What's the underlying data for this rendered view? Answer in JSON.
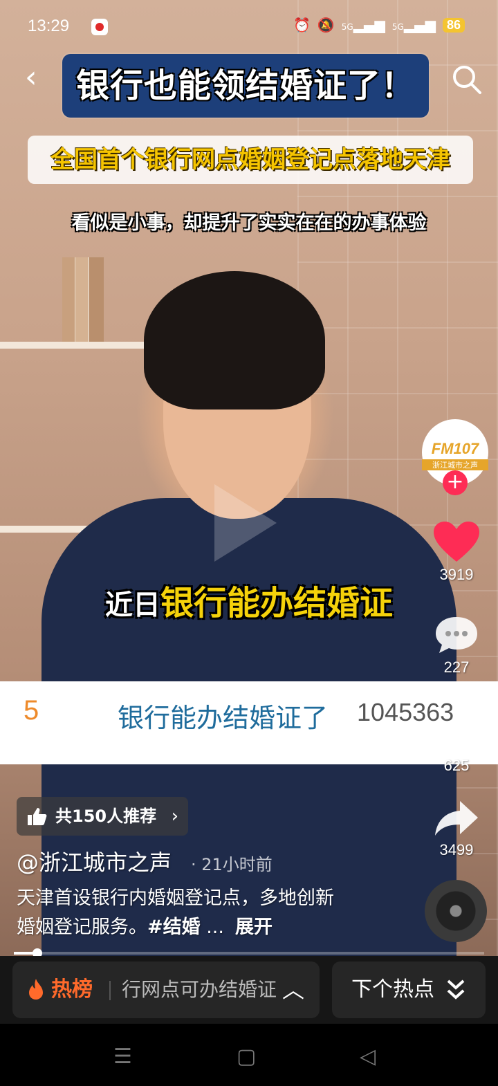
{
  "status_bar": {
    "time": "13:29",
    "signal_1": "5G",
    "signal_2": "5G",
    "battery": "86"
  },
  "video": {
    "title_overlay": "银行也能领结婚证了！",
    "subtitle_overlay": "全国首个银行网点婚姻登记点落地天津",
    "caption_top": "看似是小事，却提升了实实在在的办事体验",
    "caption_mid_white": "近日",
    "caption_mid_yellow": "银行能办结婚证"
  },
  "trend_banner": {
    "rank": "5",
    "text": "银行能办结婚证了",
    "count": "1045363"
  },
  "right_rail": {
    "avatar_logo": "FM107",
    "avatar_sub": "浙江城市之声",
    "follow_symbol": "+",
    "likes": "3919",
    "comments": "227",
    "favorites": "625",
    "shares": "3499"
  },
  "info": {
    "recommend_label": "共150人推荐",
    "author": "@浙江城市之声",
    "time_ago": "· 21小时前",
    "desc_line1": "天津首设银行内婚姻登记点，多地创新",
    "desc_line2": "婚姻登记服务。",
    "desc_tag": "#结婚",
    "desc_ellipsis": "...",
    "expand": "展开",
    "progress": 0.05
  },
  "bottom_bar": {
    "hot_label": "热榜",
    "hot_scroll": "行网点可办结婚证",
    "next_label": "下个热点"
  },
  "colors": {
    "accent_red": "#fe2c55",
    "trend_orange": "#ee8a2a",
    "title_blue": "#1d3f7a",
    "caption_yellow": "#f5d20a"
  }
}
